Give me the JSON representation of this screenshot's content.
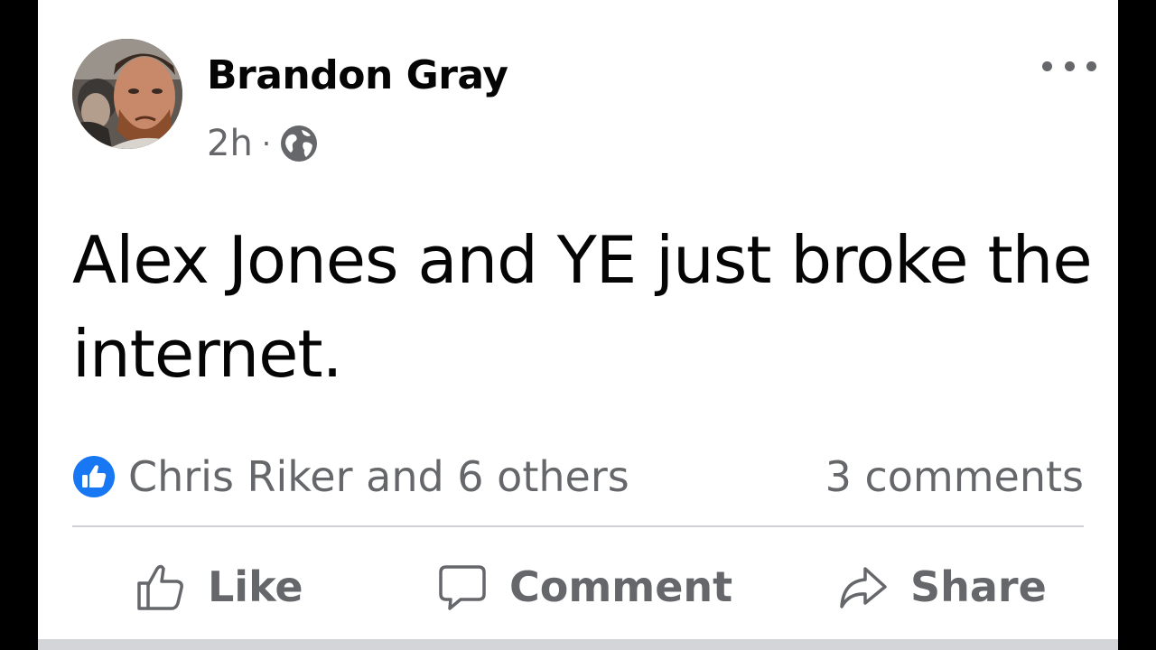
{
  "post": {
    "author": "Brandon Gray",
    "time": "2h",
    "separator": "·",
    "audience_icon": "globe-icon",
    "more_icon": "ellipsis-icon",
    "text": "Alex Jones and YE just broke the internet."
  },
  "reactions": {
    "icon": "like-reaction-icon",
    "summary": "Chris Riker and 6 others",
    "comments": "3 comments"
  },
  "actions": {
    "like": "Like",
    "comment": "Comment",
    "share": "Share"
  },
  "colors": {
    "text_primary": "#050505",
    "text_secondary": "#65676b",
    "like_blue": "#1877f2",
    "divider": "#ced0d4",
    "frame": "#000000"
  }
}
